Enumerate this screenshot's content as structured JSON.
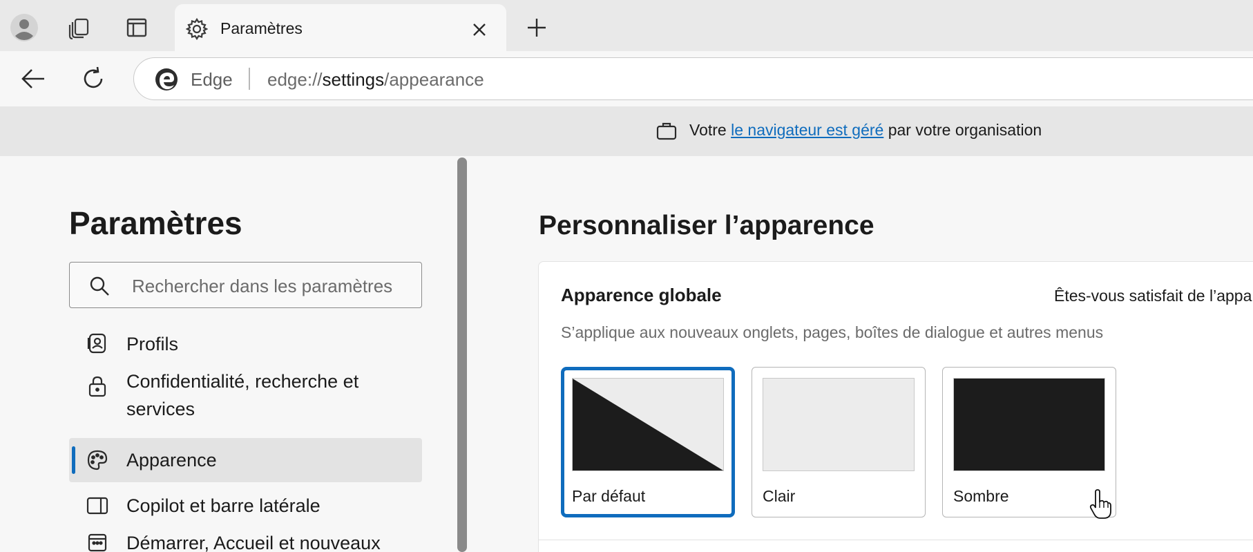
{
  "tabstrip": {
    "tab_title": "Paramètres",
    "icons": [
      "profile-icon",
      "collections-icon",
      "vertical-tabs-icon",
      "settings-gear-icon",
      "close-icon",
      "new-tab-icon"
    ]
  },
  "toolbar": {
    "site_label": "Edge",
    "url_prefix": "edge://",
    "url_host": "settings",
    "url_path": "/appearance"
  },
  "banner": {
    "text_before": "Votre ",
    "link": "le navigateur est géré",
    "text_after": " par votre organisation"
  },
  "sidebar": {
    "title": "Paramètres",
    "search_placeholder": "Rechercher dans les paramètres",
    "items": [
      {
        "label": "Profils",
        "icon": "profile-card-icon"
      },
      {
        "label": "Confidentialité, recherche et services",
        "icon": "lock-icon"
      },
      {
        "label": "Apparence",
        "icon": "palette-icon",
        "active": true
      },
      {
        "label": "Copilot et barre latérale",
        "icon": "sidebar-panel-icon"
      },
      {
        "label": "Démarrer, Accueil et nouveaux",
        "icon": "calendar-icon"
      }
    ]
  },
  "main": {
    "title": "Personnaliser l’apparence",
    "card": {
      "title": "Apparence globale",
      "feedback": "Êtes-vous satisfait de l’appa",
      "description": "S’applique aux nouveaux onglets, pages, boîtes de dialogue et autres menus",
      "themes": [
        {
          "label": "Par défaut",
          "selected": true
        },
        {
          "label": "Clair",
          "selected": false
        },
        {
          "label": "Sombre",
          "selected": false
        }
      ]
    }
  },
  "colors": {
    "accent": "#0f6cbd",
    "dark_preview": "#1c1c1c",
    "light_preview": "#ececec"
  }
}
